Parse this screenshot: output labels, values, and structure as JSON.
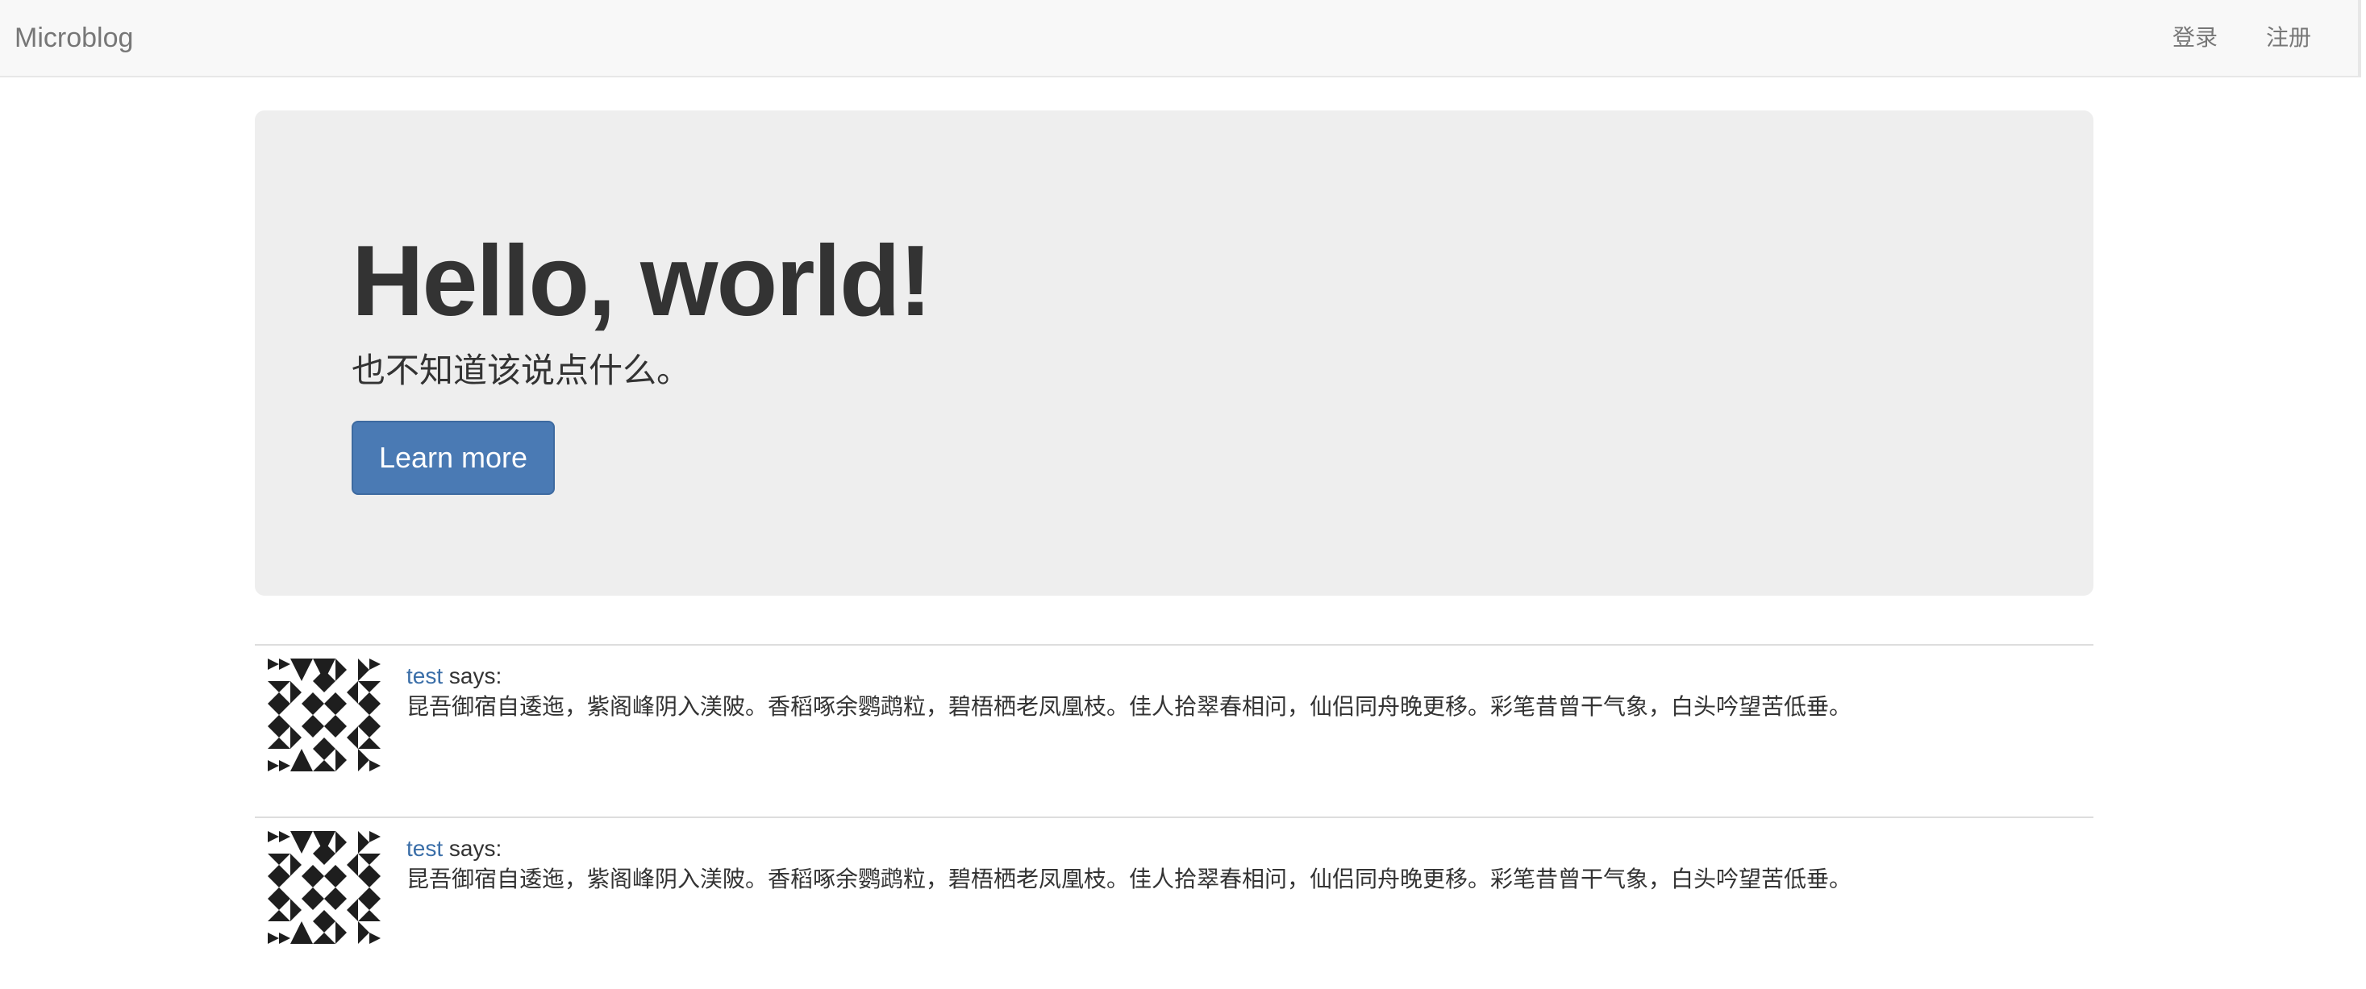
{
  "navbar": {
    "brand": "Microblog",
    "links": [
      {
        "label": "登录"
      },
      {
        "label": "注册"
      }
    ]
  },
  "jumbotron": {
    "title": "Hello, world!",
    "subtitle": "也不知道该说点什么。",
    "button_label": "Learn more",
    "background": "#eeeeee",
    "button_color": "#4a7ab4"
  },
  "posts": [
    {
      "author": "test",
      "says": " says:",
      "body": "昆吾御宿自逶迤，紫阁峰阴入渼陂。香稻啄余鹦鹉粒，碧梧栖老凤凰枝。佳人拾翠春相问，仙侣同舟晚更移。彩笔昔曾干气象，白头吟望苦低垂。",
      "avatar": "identicon-avatar"
    },
    {
      "author": "test",
      "says": " says:",
      "body": "昆吾御宿自逶迤，紫阁峰阴入渼陂。香稻啄余鹦鹉粒，碧梧栖老凤凰枝。佳人拾翠春相问，仙侣同舟晚更移。彩笔昔曾干气象，白头吟望苦低垂。",
      "avatar": "identicon-avatar"
    }
  ],
  "colors": {
    "link": "#3a6ea8",
    "navbar_bg": "#f8f8f8",
    "text": "#333333"
  }
}
